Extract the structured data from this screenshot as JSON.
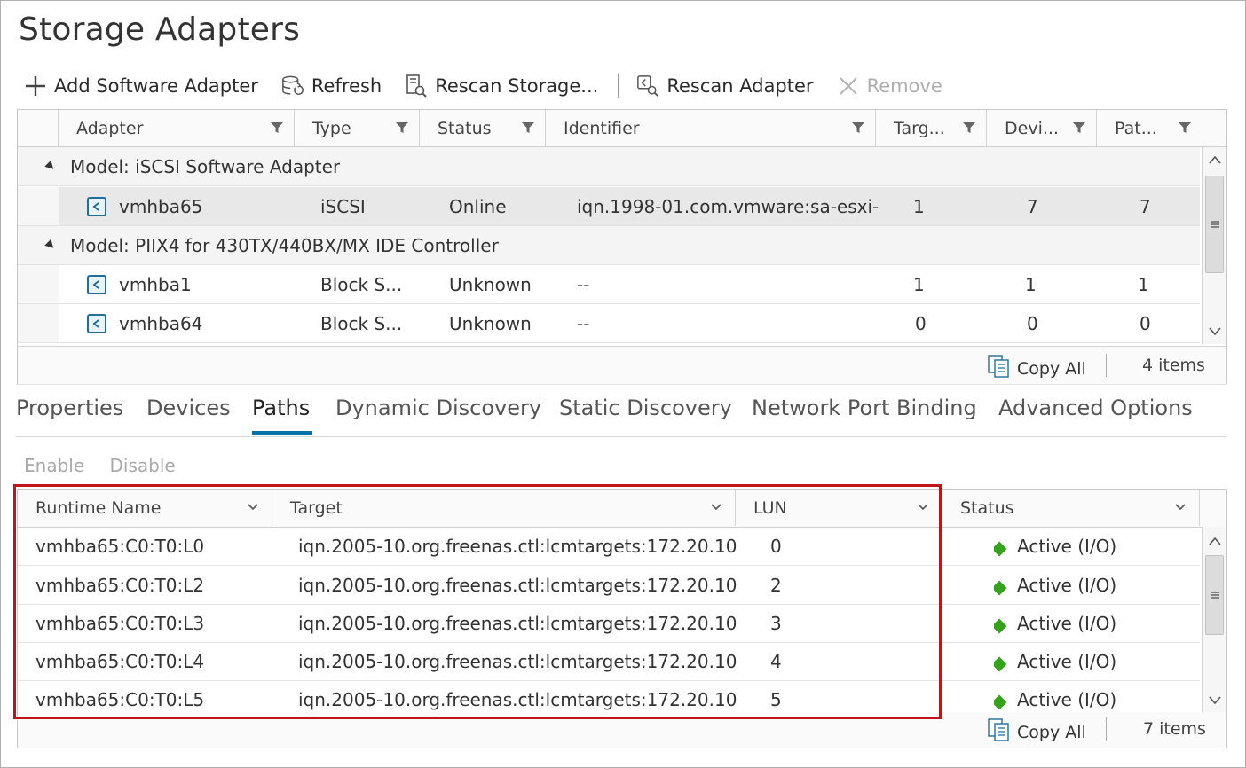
{
  "page": {
    "title": "Storage Adapters"
  },
  "toolbar": {
    "add_software_adapter": "Add Software Adapter",
    "refresh": "Refresh",
    "rescan_storage": "Rescan Storage...",
    "rescan_adapter": "Rescan Adapter",
    "remove": "Remove"
  },
  "adapters": {
    "columns": [
      "Adapter",
      "Type",
      "Status",
      "Identifier",
      "Targ...",
      "Devi...",
      "Pat..."
    ],
    "groups": [
      {
        "label": "Model: iSCSI Software Adapter"
      },
      {
        "label": "Model: PIIX4 for 430TX/440BX/MX IDE Controller"
      }
    ],
    "rows": [
      {
        "adapter": "vmhba65",
        "type": "iSCSI",
        "status": "Online",
        "identifier": "iqn.1998-01.com.vmware:sa-esxi-...",
        "targets": "1",
        "devices": "7",
        "paths": "7"
      },
      {
        "adapter": "vmhba1",
        "type": "Block S...",
        "status": "Unknown",
        "identifier": "--",
        "targets": "1",
        "devices": "1",
        "paths": "1"
      },
      {
        "adapter": "vmhba64",
        "type": "Block S...",
        "status": "Unknown",
        "identifier": "--",
        "targets": "0",
        "devices": "0",
        "paths": "0"
      }
    ],
    "footer": {
      "copy_all": "Copy All",
      "count": "4 items"
    }
  },
  "tabs": [
    "Properties",
    "Devices",
    "Paths",
    "Dynamic Discovery",
    "Static Discovery",
    "Network Port Binding",
    "Advanced Options"
  ],
  "active_tab": "Paths",
  "paths_toolbar": {
    "enable": "Enable",
    "disable": "Disable"
  },
  "paths": {
    "columns": [
      "Runtime Name",
      "Target",
      "LUN",
      "Status"
    ],
    "rows": [
      {
        "runtime": "vmhba65:C0:T0:L0",
        "target": "iqn.2005-10.org.freenas.ctl:lcmtargets:172.20.10.1...",
        "lun": "0",
        "status": "Active (I/O)"
      },
      {
        "runtime": "vmhba65:C0:T0:L2",
        "target": "iqn.2005-10.org.freenas.ctl:lcmtargets:172.20.10.1...",
        "lun": "2",
        "status": "Active (I/O)"
      },
      {
        "runtime": "vmhba65:C0:T0:L3",
        "target": "iqn.2005-10.org.freenas.ctl:lcmtargets:172.20.10.1...",
        "lun": "3",
        "status": "Active (I/O)"
      },
      {
        "runtime": "vmhba65:C0:T0:L4",
        "target": "iqn.2005-10.org.freenas.ctl:lcmtargets:172.20.10.1...",
        "lun": "4",
        "status": "Active (I/O)"
      },
      {
        "runtime": "vmhba65:C0:T0:L5",
        "target": "iqn.2005-10.org.freenas.ctl:lcmtargets:172.20.10.1...",
        "lun": "5",
        "status": "Active (I/O)"
      }
    ],
    "footer": {
      "copy_all": "Copy All",
      "count": "7 items"
    }
  },
  "colors": {
    "accent": "#0072a3",
    "status_active": "#35a21c",
    "highlight": "#c0141a"
  }
}
